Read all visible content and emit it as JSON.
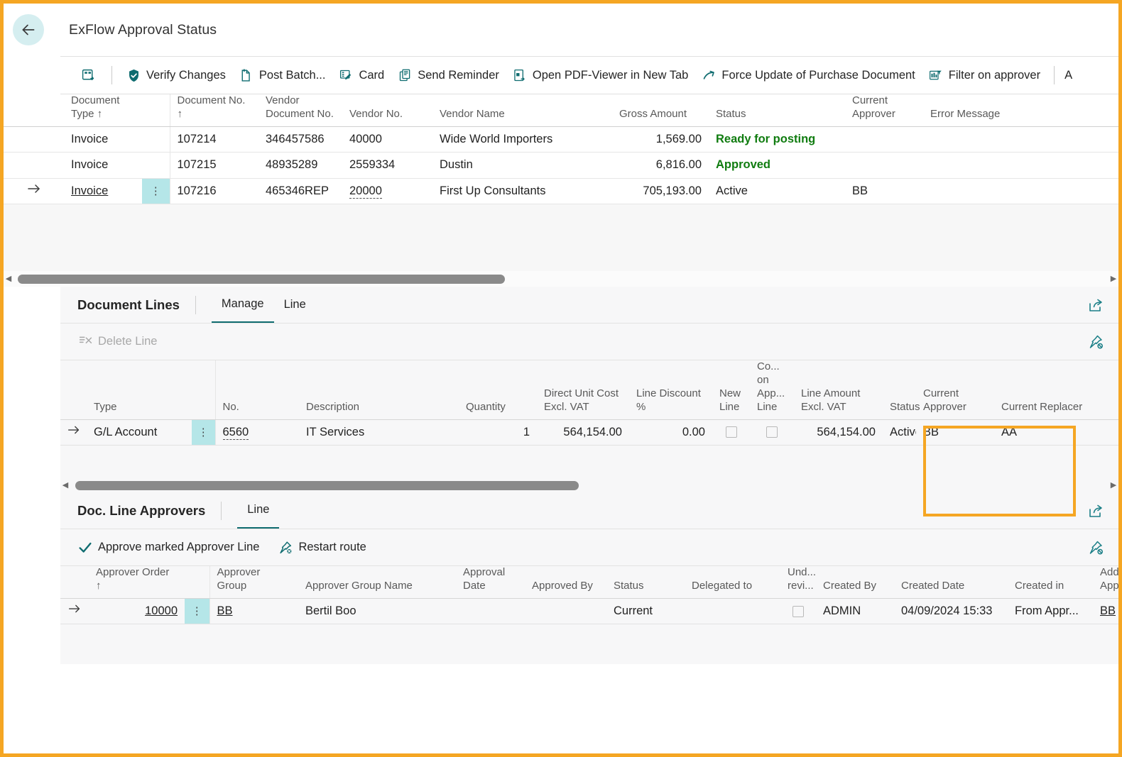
{
  "window": {
    "title": "ExFlow Approval Status",
    "back_icon": "back-arrow-icon",
    "accent_color": "#f5a623",
    "teal": "#0f6c70",
    "status_green": "#107c10",
    "selection_cyan": "#b5e6e8"
  },
  "ribbon": {
    "open_in_excel_icon": "open-in-new-window-icon",
    "items": [
      {
        "label": "Verify Changes",
        "icon": "verify-shield-icon"
      },
      {
        "label": "Post Batch...",
        "icon": "post-document-icon"
      },
      {
        "label": "Card",
        "icon": "card-icon"
      },
      {
        "label": "Send Reminder",
        "icon": "send-reminder-icon"
      },
      {
        "label": "Open PDF-Viewer in New Tab",
        "icon": "pdf-viewer-icon"
      },
      {
        "label": "Force Update of Purchase Document",
        "icon": "force-update-arrow-icon"
      },
      {
        "label": "Filter on approver",
        "icon": "filter-approver-icon"
      }
    ],
    "truncated_item": "A"
  },
  "documents_grid": {
    "columns": [
      {
        "key": "document_type",
        "label": "Document Type ↑",
        "align": "left"
      },
      {
        "key": "document_no",
        "label": "Document No. ↑",
        "align": "left"
      },
      {
        "key": "vendor_document_no",
        "label": "Vendor Document No.",
        "align": "left"
      },
      {
        "key": "vendor_no",
        "label": "Vendor No.",
        "align": "left"
      },
      {
        "key": "vendor_name",
        "label": "Vendor Name",
        "align": "left"
      },
      {
        "key": "gross_amount",
        "label": "Gross Amount",
        "align": "right"
      },
      {
        "key": "status",
        "label": "Status",
        "align": "left"
      },
      {
        "key": "current_approver",
        "label": "Current Approver",
        "align": "left"
      },
      {
        "key": "error_message",
        "label": "Error Message",
        "align": "left"
      }
    ],
    "rows": [
      {
        "selected": false,
        "document_type": "Invoice",
        "document_no": "107214",
        "vendor_document_no": "346457586",
        "vendor_no": "40000",
        "vendor_name": "Wide World Importers",
        "gross_amount": "1,569.00",
        "status": "Ready for posting",
        "status_style": "green-bold",
        "current_approver": "",
        "error_message": ""
      },
      {
        "selected": false,
        "document_type": "Invoice",
        "document_no": "107215",
        "vendor_document_no": "48935289",
        "vendor_no": "2559334",
        "vendor_name": "Dustin",
        "gross_amount": "6,816.00",
        "status": "Approved",
        "status_style": "green-bold",
        "current_approver": "",
        "error_message": ""
      },
      {
        "selected": true,
        "document_type": "Invoice",
        "document_no": "107216",
        "vendor_document_no": "465346REP",
        "vendor_no": "20000",
        "vendor_name": "First Up Consultants",
        "gross_amount": "705,193.00",
        "status": "Active",
        "status_style": "plain",
        "current_approver": "BB",
        "error_message": ""
      }
    ]
  },
  "document_lines": {
    "title": "Document Lines",
    "tabs": [
      {
        "label": "Manage",
        "active": true
      },
      {
        "label": "Line",
        "active": false
      }
    ],
    "share_icon": "share-export-icon",
    "pin_icon": "unpin-icon",
    "actions": [
      {
        "label": "Delete Line",
        "icon": "delete-line-icon",
        "disabled": true
      }
    ],
    "columns": [
      {
        "key": "type",
        "label": "Type",
        "align": "left"
      },
      {
        "key": "no",
        "label": "No.",
        "align": "left"
      },
      {
        "key": "description",
        "label": "Description",
        "align": "left"
      },
      {
        "key": "quantity",
        "label": "Quantity",
        "align": "right"
      },
      {
        "key": "direct_unit_cost",
        "label": "Direct Unit Cost Excl. VAT",
        "align": "right"
      },
      {
        "key": "line_discount_pct",
        "label": "Line Discount %",
        "align": "right"
      },
      {
        "key": "new_line",
        "label": "New Line",
        "align": "left"
      },
      {
        "key": "comment_on_approval_line",
        "label": "Co... on App... Line",
        "align": "left"
      },
      {
        "key": "line_amount",
        "label": "Line Amount Excl. VAT",
        "align": "right"
      },
      {
        "key": "status",
        "label": "Status",
        "align": "left"
      },
      {
        "key": "current_approver",
        "label": "Current Approver",
        "align": "left"
      },
      {
        "key": "current_replacer",
        "label": "Current Replacer",
        "align": "left"
      }
    ],
    "rows": [
      {
        "selected": true,
        "type": "G/L Account",
        "no": "6560",
        "description": "IT Services",
        "quantity": "1",
        "direct_unit_cost": "564,154.00",
        "line_discount_pct": "0.00",
        "new_line": false,
        "comment_on_approval_line": false,
        "line_amount": "564,154.00",
        "status": "Active",
        "current_approver": "BB",
        "current_replacer": "AA"
      }
    ],
    "highlight": {
      "columns": [
        "Current Approver",
        "Current Replacer"
      ],
      "color": "#f5a623"
    }
  },
  "doc_line_approvers": {
    "title": "Doc. Line Approvers",
    "tabs": [
      {
        "label": "Line",
        "active": true
      }
    ],
    "share_icon": "share-export-icon",
    "pin_icon": "unpin-icon",
    "actions": [
      {
        "label": "Approve marked Approver Line",
        "icon": "checkmark-icon",
        "disabled": false
      },
      {
        "label": "Restart route",
        "icon": "restart-route-icon",
        "disabled": false
      }
    ],
    "columns": [
      {
        "key": "approver_order",
        "label": "Approver Order ↑",
        "align": "right"
      },
      {
        "key": "approver_group",
        "label": "Approver Group",
        "align": "left"
      },
      {
        "key": "approver_group_name",
        "label": "Approver Group Name",
        "align": "left"
      },
      {
        "key": "approval_date",
        "label": "Approval Date",
        "align": "left"
      },
      {
        "key": "approved_by",
        "label": "Approved By",
        "align": "left"
      },
      {
        "key": "status",
        "label": "Status",
        "align": "left"
      },
      {
        "key": "delegated_to",
        "label": "Delegated to",
        "align": "left"
      },
      {
        "key": "under_review",
        "label": "Und... revi...",
        "align": "left"
      },
      {
        "key": "created_by",
        "label": "Created By",
        "align": "left"
      },
      {
        "key": "created_date",
        "label": "Created Date",
        "align": "left"
      },
      {
        "key": "created_in",
        "label": "Created in",
        "align": "left"
      },
      {
        "key": "added_approver",
        "label": "Added Appro",
        "align": "left"
      }
    ],
    "rows": [
      {
        "selected": true,
        "approver_order": "10000",
        "approver_group": "BB",
        "approver_group_name": "Bertil Boo",
        "approval_date": "",
        "approved_by": "",
        "status": "Current",
        "delegated_to": "",
        "under_review": false,
        "created_by": "ADMIN",
        "created_date": "04/09/2024 15:33",
        "created_in": "From Appr...",
        "added_approver": "BB"
      }
    ]
  },
  "scrollbars": {
    "top": {
      "left_arrow": "◀",
      "right_arrow": "▶",
      "thumb_start_pct": 0.4,
      "thumb_width_pct": 44.5
    },
    "lines": {
      "left_arrow": "◀",
      "right_arrow": "▶",
      "thumb_start_pct": 0.5,
      "thumb_width_pct": 48.5
    },
    "approvers": {
      "left_arrow": "◀",
      "right_arrow": "▶",
      "thumb_start_pct": 0.5,
      "thumb_width_pct": 100
    }
  }
}
